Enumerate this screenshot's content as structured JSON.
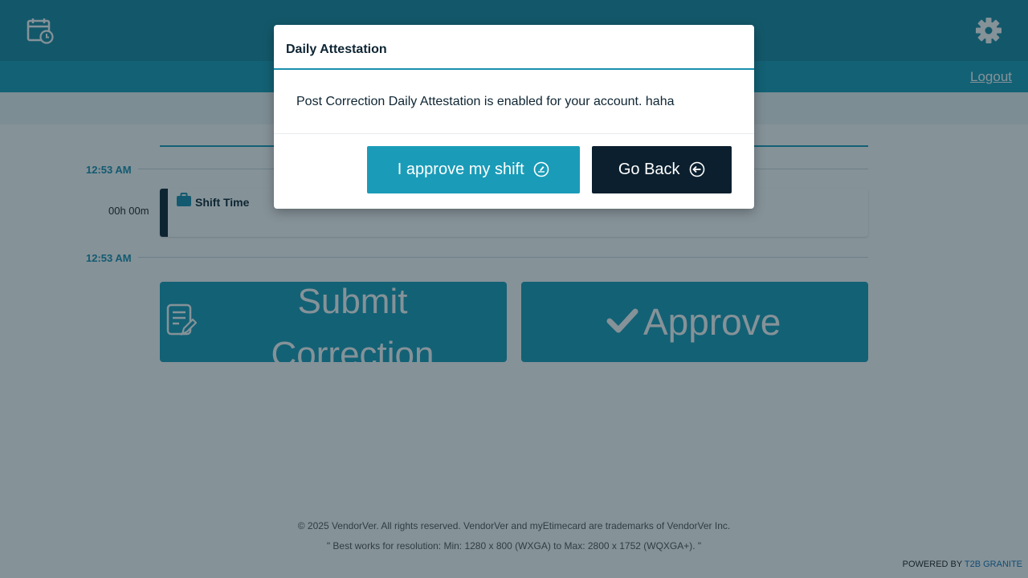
{
  "header": {
    "calendar_icon": "calendar-clock-icon",
    "settings_icon": "gear-icon",
    "logout_label": "Logout"
  },
  "timeline": {
    "start_time": "12:53 AM",
    "end_time": "12:53 AM",
    "duration": "00h 00m",
    "shift_title": "Shift Time"
  },
  "actions": {
    "submit_label_line1": "Submit",
    "submit_label_line2": "Correction",
    "approve_label": "Approve"
  },
  "footer": {
    "copyright": "© 2025 VendorVer. All rights reserved. VendorVer and myEtimecard are trademarks of VendorVer Inc.",
    "resolution_note": "\" Best works for resolution: Min: 1280 x 800 (WXGA) to Max: 2800 x 1752 (WQXGA+). \"",
    "powered_prefix": "POWERED BY",
    "powered_brand": "T2B GRANITE"
  },
  "modal": {
    "title": "Daily Attestation",
    "message": "Post Correction Daily Attestation is enabled for your account. haha",
    "approve_button": "I approve my shift",
    "back_button": "Go Back"
  },
  "colors": {
    "primary": "#1a9cb8",
    "dark": "#0b1f2e",
    "overlay": "rgba(11,37,50,0.5)"
  }
}
